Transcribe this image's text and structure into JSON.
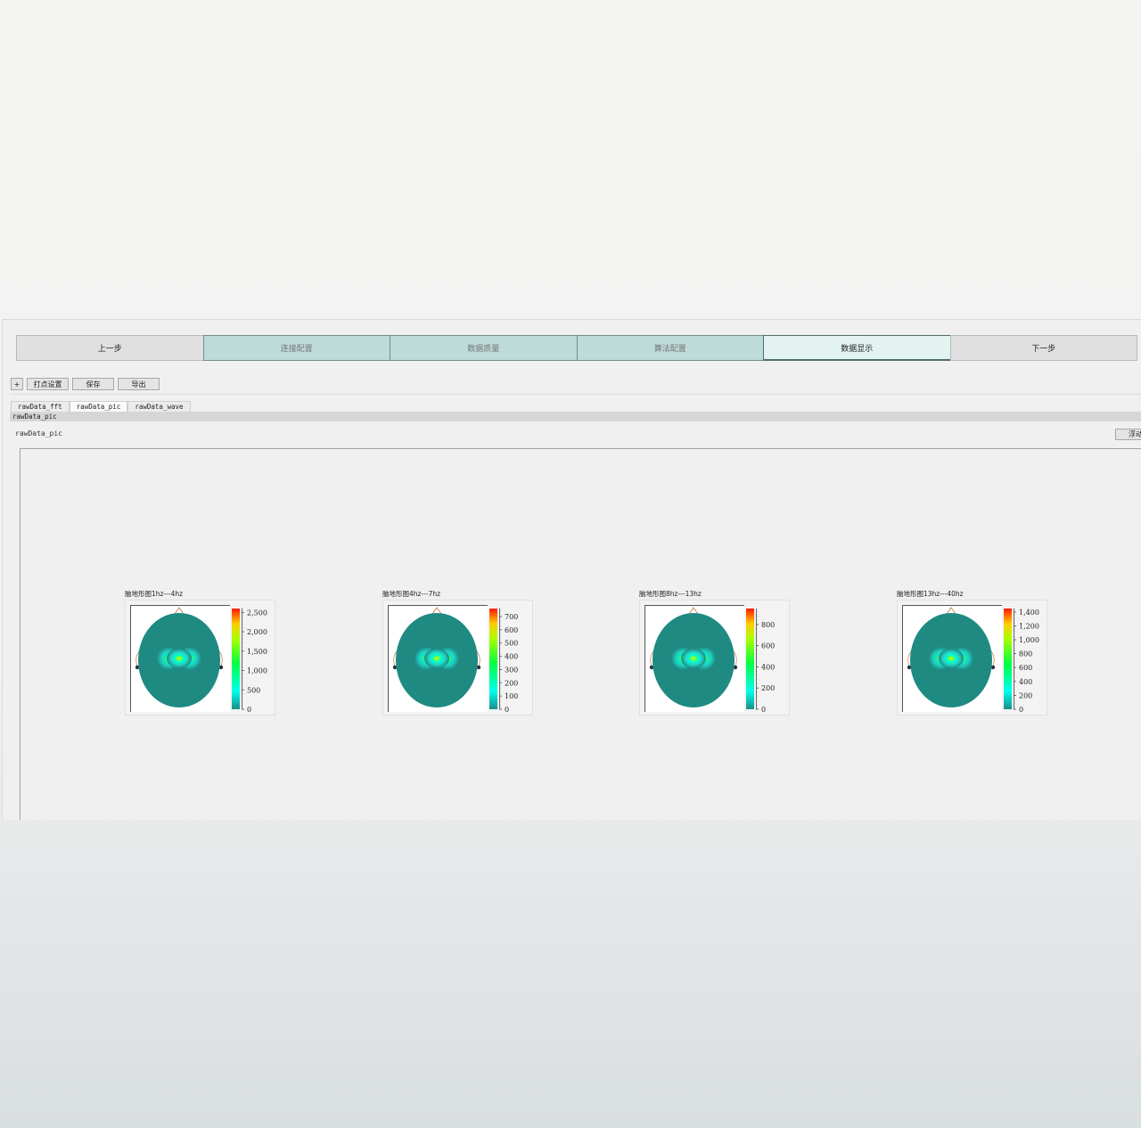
{
  "steps": [
    {
      "label": "上一步",
      "state": "nav"
    },
    {
      "label": "连接配置",
      "state": "done"
    },
    {
      "label": "数据质量",
      "state": "done"
    },
    {
      "label": "算法配置",
      "state": "done"
    },
    {
      "label": "数据显示",
      "state": "active"
    },
    {
      "label": "下一步",
      "state": "nav"
    }
  ],
  "toolbar": {
    "plus": "+",
    "mark_settings": "打点设置",
    "save": "保存",
    "export": "导出"
  },
  "tabs": [
    {
      "label": "rawData_fft",
      "active": false
    },
    {
      "label": "rawData_pic",
      "active": true
    },
    {
      "label": "rawData_wave",
      "active": false
    }
  ],
  "subheader": "rawData_pic",
  "panel_title": "rawData_pic",
  "float_button": "浮动",
  "topomaps": [
    {
      "title": "脑地形图1hz---4hz",
      "ticks": [
        "2,500",
        "2,000",
        "1,500",
        "1,000",
        "500",
        "0"
      ],
      "max": 2600
    },
    {
      "title": "脑地形图4hz---7hz",
      "ticks": [
        "700",
        "600",
        "500",
        "400",
        "300",
        "200",
        "100",
        "0"
      ],
      "max": 760
    },
    {
      "title": "脑地形图8hz---13hz",
      "ticks": [
        "800",
        "600",
        "400",
        "200",
        "0"
      ],
      "max": 950
    },
    {
      "title": "脑地形图13hz---40hz",
      "ticks": [
        "1,400",
        "1,200",
        "1,000",
        "800",
        "600",
        "400",
        "200",
        "0"
      ],
      "max": 1450
    }
  ],
  "colors": {
    "head": "#1e8a82",
    "step_done": "#bcdbd9",
    "step_active": "#e2f3f2"
  }
}
